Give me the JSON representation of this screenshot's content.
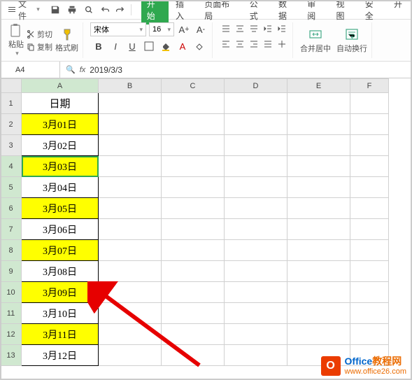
{
  "menu": {
    "file": "文件",
    "tabs": [
      "开始",
      "插入",
      "页面布局",
      "公式",
      "数据",
      "审阅",
      "视图",
      "安全",
      "开"
    ]
  },
  "ribbon": {
    "paste": "粘贴",
    "cut": "剪切",
    "copy": "复制",
    "format_painter": "格式刷",
    "font_name": "宋体",
    "font_size": "16",
    "merge_center": "合并居中",
    "wrap_text": "自动换行"
  },
  "formula_bar": {
    "name_box": "A4",
    "fx": "fx",
    "value": "2019/3/3"
  },
  "columns": [
    "A",
    "B",
    "C",
    "D",
    "E",
    "F"
  ],
  "row_headers": [
    "1",
    "2",
    "3",
    "4",
    "5",
    "6",
    "7",
    "8",
    "9",
    "10",
    "11",
    "12",
    "13"
  ],
  "cells": {
    "A1": "日期",
    "A2": "3月01日",
    "A3": "3月02日",
    "A4": "3月03日",
    "A5": "3月04日",
    "A6": "3月05日",
    "A7": "3月06日",
    "A8": "3月07日",
    "A9": "3月08日",
    "A10": "3月09日",
    "A11": "3月10日",
    "A12": "3月11日",
    "A13": "3月12日"
  },
  "highlight_rows": [
    2,
    4,
    6,
    8,
    10,
    12
  ],
  "selected_cell": "A4",
  "watermark": {
    "title_part1": "Office",
    "title_part2": "教程网",
    "url": "www.office26.com",
    "icon_letter": "O"
  }
}
